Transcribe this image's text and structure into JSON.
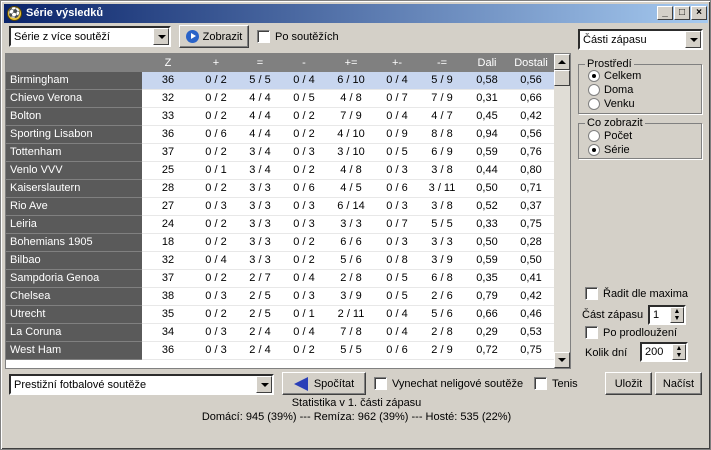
{
  "window": {
    "title": "Série výsledků",
    "icon": "soccer-ball-icon"
  },
  "toolbar": {
    "mode_combo": "Série z více soutěží",
    "show_button": "Zobrazit",
    "by_competition_label": "Po soutěžích",
    "by_competition_checked": false
  },
  "table": {
    "columns": [
      "Z",
      "+",
      "=",
      "-",
      "+=",
      "+-",
      "-=",
      "Dali",
      "Dostali"
    ],
    "selected_row": 0,
    "rows": [
      {
        "team": "Birmingham",
        "cells": [
          "36",
          "0 / 2",
          "5 / 5",
          "0 / 4",
          "6 / 10",
          "0 / 4",
          "5 / 9",
          "0,58",
          "0,56"
        ]
      },
      {
        "team": "Chievo Verona",
        "cells": [
          "32",
          "0 / 2",
          "4 / 4",
          "0 / 5",
          "4 / 8",
          "0 / 7",
          "7 / 9",
          "0,31",
          "0,66"
        ]
      },
      {
        "team": "Bolton",
        "cells": [
          "33",
          "0 / 2",
          "4 / 4",
          "0 / 2",
          "7 / 9",
          "0 / 4",
          "4 / 7",
          "0,45",
          "0,42"
        ]
      },
      {
        "team": "Sporting Lisabon",
        "cells": [
          "36",
          "0 / 6",
          "4 / 4",
          "0 / 2",
          "4 / 10",
          "0 / 9",
          "8 / 8",
          "0,94",
          "0,56"
        ]
      },
      {
        "team": "Tottenham",
        "cells": [
          "37",
          "0 / 2",
          "3 / 4",
          "0 / 3",
          "3 / 10",
          "0 / 5",
          "6 / 9",
          "0,59",
          "0,76"
        ]
      },
      {
        "team": "Venlo VVV",
        "cells": [
          "25",
          "0 / 1",
          "3 / 4",
          "0 / 2",
          "4 / 8",
          "0 / 3",
          "3 / 8",
          "0,44",
          "0,80"
        ]
      },
      {
        "team": "Kaiserslautern",
        "cells": [
          "28",
          "0 / 2",
          "3 / 3",
          "0 / 6",
          "4 / 5",
          "0 / 6",
          "3 / 11",
          "0,50",
          "0,71"
        ]
      },
      {
        "team": "Rio Ave",
        "cells": [
          "27",
          "0 / 3",
          "3 / 3",
          "0 / 3",
          "6 / 14",
          "0 / 3",
          "3 / 8",
          "0,52",
          "0,37"
        ]
      },
      {
        "team": "Leiria",
        "cells": [
          "24",
          "0 / 2",
          "3 / 3",
          "0 / 3",
          "3 / 3",
          "0 / 7",
          "5 / 5",
          "0,33",
          "0,75"
        ]
      },
      {
        "team": "Bohemians 1905",
        "cells": [
          "18",
          "0 / 2",
          "3 / 3",
          "0 / 2",
          "6 / 6",
          "0 / 3",
          "3 / 3",
          "0,50",
          "0,28"
        ]
      },
      {
        "team": "Bilbao",
        "cells": [
          "32",
          "0 / 4",
          "3 / 3",
          "0 / 2",
          "5 / 6",
          "0 / 8",
          "3 / 9",
          "0,59",
          "0,50"
        ]
      },
      {
        "team": "Sampdoria Genoa",
        "cells": [
          "37",
          "0 / 2",
          "2 / 7",
          "0 / 4",
          "2 / 8",
          "0 / 5",
          "6 / 8",
          "0,35",
          "0,41"
        ]
      },
      {
        "team": "Chelsea",
        "cells": [
          "38",
          "0 / 3",
          "2 / 5",
          "0 / 3",
          "3 / 9",
          "0 / 5",
          "2 / 6",
          "0,79",
          "0,42"
        ]
      },
      {
        "team": "Utrecht",
        "cells": [
          "35",
          "0 / 2",
          "2 / 5",
          "0 / 1",
          "2 / 11",
          "0 / 4",
          "5 / 6",
          "0,66",
          "0,46"
        ]
      },
      {
        "team": "La Coruna",
        "cells": [
          "34",
          "0 / 3",
          "2 / 4",
          "0 / 4",
          "7 / 8",
          "0 / 4",
          "2 / 8",
          "0,29",
          "0,53"
        ]
      },
      {
        "team": "West Ham",
        "cells": [
          "36",
          "0 / 3",
          "2 / 4",
          "0 / 2",
          "5 / 5",
          "0 / 6",
          "2 / 9",
          "0,72",
          "0,75"
        ]
      }
    ]
  },
  "right_panel": {
    "part_combo": "Části zápasu",
    "environment": {
      "title": "Prostředí",
      "options": [
        "Celkem",
        "Doma",
        "Venku"
      ],
      "selected": 0
    },
    "show": {
      "title": "Co zobrazit",
      "options": [
        "Počet",
        "Série"
      ],
      "selected": 1
    },
    "sort_by_max_label": "Řadit dle maxima",
    "match_part_label": "Část zápasu",
    "match_part_value": "1",
    "overtime_label": "Po prodloužení",
    "days_label": "Kolik dní",
    "days_value": "200"
  },
  "bottom": {
    "competition_combo": "Prestižní fotbalové soutěže",
    "calculate_button": "Spočítat",
    "skip_non_league_label": "Vynechat neligové soutěže",
    "tennis_label": "Tenis",
    "save_button": "Uložit",
    "load_button": "Načíst"
  },
  "status": {
    "line1": "Statistika v 1. části zápasu",
    "line2": "Domácí: 945 (39%) --- Remíza: 962 (39%) --- Hosté: 535 (22%)"
  }
}
